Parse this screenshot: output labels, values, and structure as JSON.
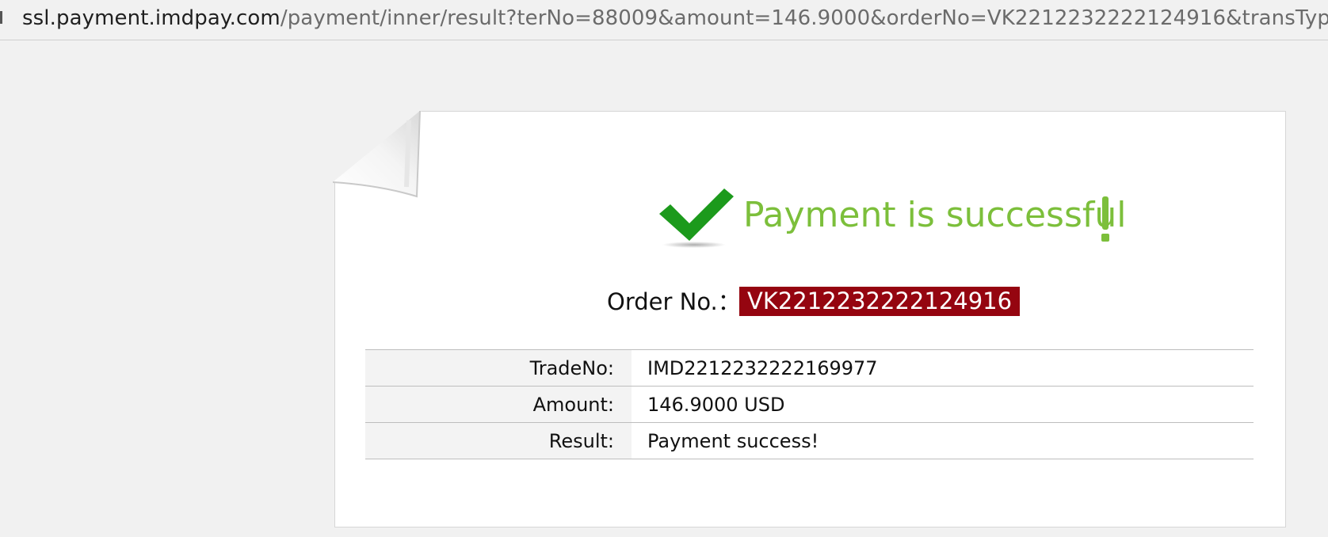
{
  "browser": {
    "url_host": "ssl.payment.imdpay.com",
    "url_path": "/payment/inner/result?terNo=88009&amount=146.9000&orderNo=VK2212232222124916&transTyp..."
  },
  "result": {
    "title": "Payment is successful",
    "order_label": "Order No.：",
    "order_no": "VK2212232222124916",
    "rows": [
      {
        "label": "TradeNo:",
        "value": "IMD2212232222169977"
      },
      {
        "label": "Amount:",
        "value": "146.9000 USD"
      },
      {
        "label": "Result:",
        "value": "Payment success!"
      }
    ]
  },
  "colors": {
    "success_green": "#7cbf3b",
    "check_green": "#1c9a1c",
    "order_badge": "#950510"
  },
  "icons": {
    "check": "checkmark-icon",
    "exclamation": "exclamation-icon"
  }
}
